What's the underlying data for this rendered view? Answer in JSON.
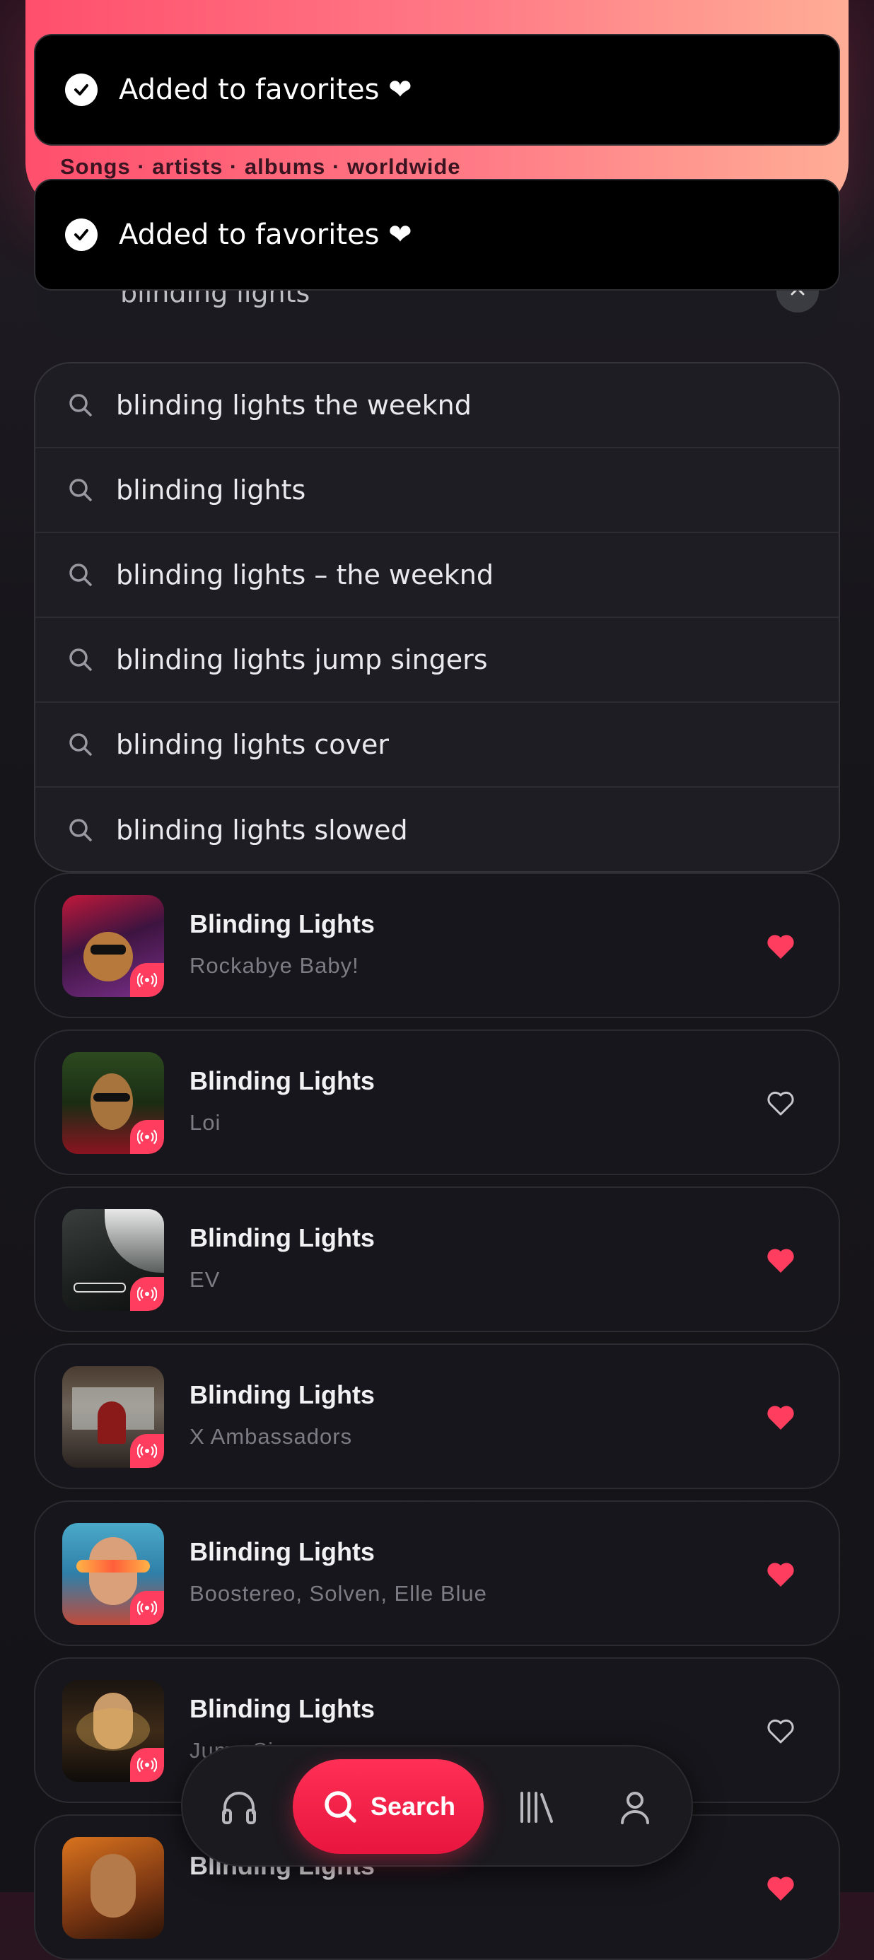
{
  "header": {
    "subtitle": "Songs · artists · albums · worldwide"
  },
  "toasts": [
    {
      "message": "Added to favorites ❤"
    },
    {
      "message": "Added to favorites ❤"
    }
  ],
  "search": {
    "query": "blinding lights"
  },
  "suggestions": [
    "blinding lights the weeknd",
    "blinding lights",
    "blinding lights – the weeknd",
    "blinding lights jump singers",
    "blinding lights cover",
    "blinding lights slowed"
  ],
  "results": [
    {
      "title": "Blinding Lights",
      "artist": "Rockabye Baby!",
      "favorited": true
    },
    {
      "title": "Blinding Lights",
      "artist": "Loi",
      "favorited": false
    },
    {
      "title": "Blinding Lights",
      "artist": "EV",
      "favorited": true
    },
    {
      "title": "Blinding Lights",
      "artist": "X Ambassadors",
      "favorited": true
    },
    {
      "title": "Blinding Lights",
      "artist": "Boostereo, Solven, Elle Blue",
      "favorited": true
    },
    {
      "title": "Blinding Lights",
      "artist": "Jump Singers",
      "favorited": false
    },
    {
      "title": "Blinding Lights",
      "artist": "",
      "favorited": true
    }
  ],
  "nav": {
    "active_label": "Search",
    "items": [
      "headphones-icon",
      "search-icon",
      "library-icon",
      "profile-icon"
    ]
  },
  "colors": {
    "accent": "#ff3d5e",
    "heart": "#ff3d5e",
    "header_start": "#ff4f6d",
    "header_end": "#ffad96"
  }
}
